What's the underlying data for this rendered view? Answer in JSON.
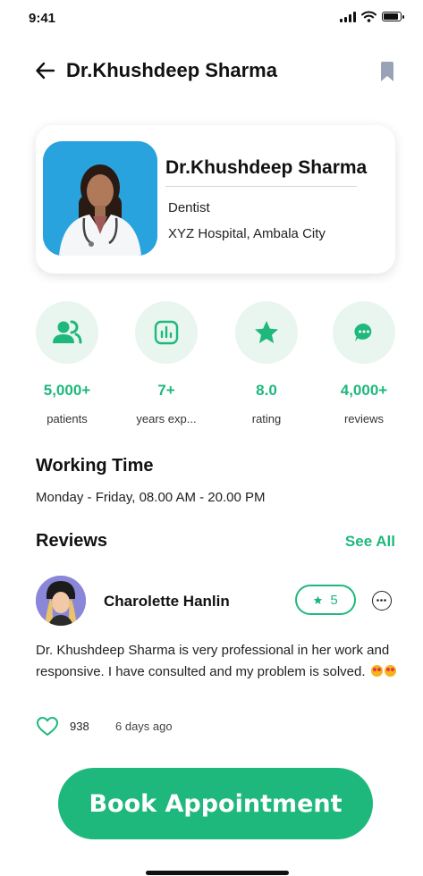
{
  "status_bar": {
    "time": "9:41"
  },
  "header": {
    "title": "Dr.Khushdeep Sharma",
    "back_icon": "arrow-left-icon",
    "bookmark_icon": "bookmark-icon"
  },
  "doctor": {
    "name": "Dr.Khushdeep Sharma",
    "specialty": "Dentist",
    "hospital": "XYZ Hospital, Ambala City"
  },
  "stats": [
    {
      "icon": "patients-icon",
      "value": "5,000+",
      "label": "patients"
    },
    {
      "icon": "chart-icon",
      "value": "7+",
      "label": "years exp..."
    },
    {
      "icon": "star-icon",
      "value": "8.0",
      "label": "rating"
    },
    {
      "icon": "chat-icon",
      "value": "4,000+",
      "label": "reviews"
    }
  ],
  "working_time": {
    "title": "Working Time",
    "text": "Monday - Friday, 08.00 AM - 20.00 PM"
  },
  "reviews": {
    "title": "Reviews",
    "see_all": "See All",
    "item": {
      "name": "Charolette Hanlin",
      "rating": "5",
      "text": "Dr. Khushdeep Sharma is very professional in her work and responsive. I have consulted and my problem is solved.",
      "likes": "938",
      "time_ago": "6 days ago"
    }
  },
  "cta": {
    "label": "Book Appointment"
  },
  "colors": {
    "accent": "#1fb87c",
    "accent_light": "#e8f6ef",
    "photo_bg": "#29a3de"
  }
}
